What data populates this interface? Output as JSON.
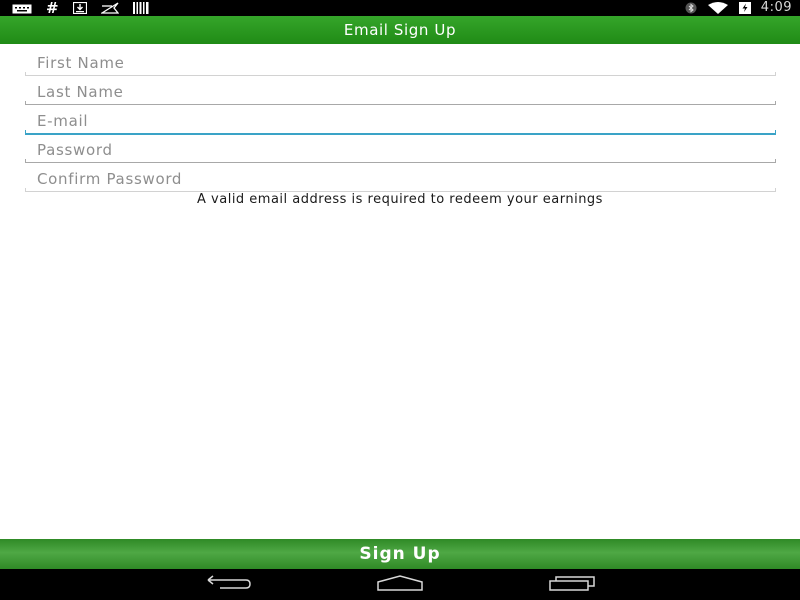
{
  "status_bar": {
    "left_icons": [
      "keyboard-icon",
      "hash-icon",
      "download-icon",
      "flag-icon",
      "barcode-icon"
    ],
    "hash_glyph": "#",
    "right_icons": [
      "bluetooth-icon",
      "wifi-icon",
      "battery-charging-icon"
    ],
    "time": "4:09"
  },
  "header": {
    "title": "Email Sign Up",
    "color": "#2a9a1f"
  },
  "form": {
    "fields": [
      {
        "placeholder": "First Name",
        "value": ""
      },
      {
        "placeholder": "Last Name",
        "value": ""
      },
      {
        "placeholder": "E-mail",
        "value": "",
        "focused": true
      },
      {
        "placeholder": "Password",
        "value": ""
      },
      {
        "placeholder": "Confirm Password",
        "value": ""
      }
    ],
    "note": "A valid email address is required to redeem your earnings"
  },
  "signup_button": {
    "label": "Sign Up"
  },
  "nav_bar": {
    "buttons": [
      "back-icon",
      "home-icon",
      "recent-apps-icon"
    ]
  },
  "colors": {
    "accent": "#3aa3c7",
    "brand_green": "#2a9a1f"
  }
}
